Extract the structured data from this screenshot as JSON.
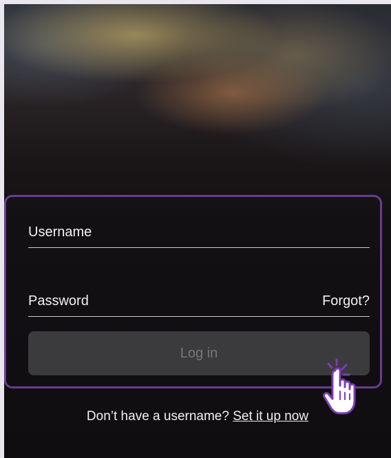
{
  "login": {
    "username_label": "Username",
    "password_label": "Password",
    "forgot_label": "Forgot?",
    "login_button_label": "Log in"
  },
  "signup": {
    "prompt": "Don’t have a username?",
    "link_label": "Set it up now"
  },
  "colors": {
    "card_border": "#6a3b91",
    "button_bg": "#3b3a3c",
    "button_text": "#777679",
    "text": "#f2f2f2"
  },
  "icons": {
    "cursor": "hand-pointer-click-icon"
  }
}
